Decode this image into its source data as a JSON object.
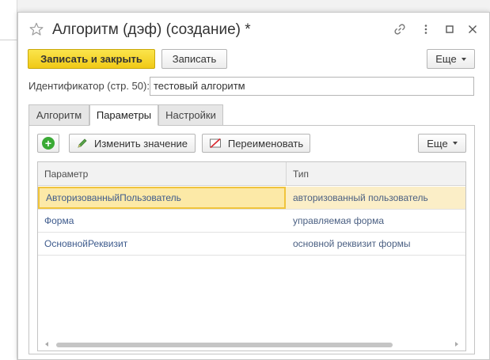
{
  "window": {
    "title": "Алгоритм (дэф) (создание) *"
  },
  "toolbar": {
    "save_close_label": "Записать и закрыть",
    "save_label": "Записать",
    "more_label": "Еще"
  },
  "identifier": {
    "label": "Идентификатор (стр. 50):",
    "value": "тестовый алгоритм"
  },
  "tabs": [
    {
      "label": "Алгоритм",
      "active": false
    },
    {
      "label": "Параметры",
      "active": true
    },
    {
      "label": "Настройки",
      "active": false
    }
  ],
  "params_toolbar": {
    "change_value_label": "Изменить значение",
    "rename_label": "Переименовать",
    "more_label": "Еще"
  },
  "table": {
    "headers": [
      "Параметр",
      "Тип"
    ],
    "rows": [
      {
        "param": "АвторизованныйПользователь",
        "type": "авторизованный пользователь",
        "selected": true
      },
      {
        "param": "Форма",
        "type": "управляемая форма",
        "selected": false
      },
      {
        "param": "ОсновнойРеквизит",
        "type": "основной реквизит формы",
        "selected": false
      }
    ]
  },
  "colors": {
    "primary_button": "#f0c916",
    "selected_row": "#fbeec7",
    "add_icon": "#3aaa35"
  }
}
